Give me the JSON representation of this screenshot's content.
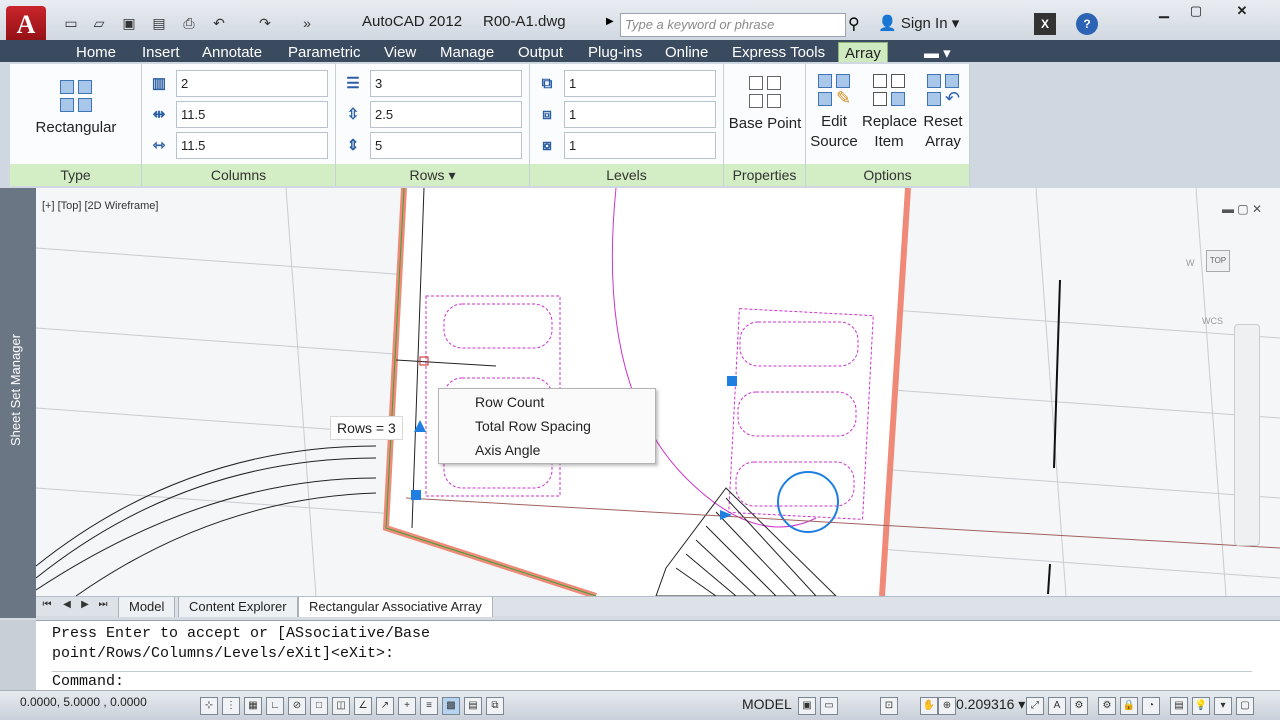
{
  "window": {
    "app_title": "AutoCAD 2012",
    "file_title": "R00-A1.dwg",
    "search_placeholder": "Type a keyword or phrase",
    "sign_in": "Sign In"
  },
  "ribbon_tabs": [
    "Home",
    "Insert",
    "Annotate",
    "Parametric",
    "View",
    "Manage",
    "Output",
    "Plug-ins",
    "Online",
    "Express Tools",
    "Array"
  ],
  "active_tab": "Array",
  "ribbon": {
    "type": {
      "button": "Rectangular",
      "label": "Type"
    },
    "columns": {
      "label": "Columns",
      "count": "2",
      "spacing": "11.5",
      "total": "11.5"
    },
    "rows": {
      "label": "Rows",
      "count": "3",
      "spacing": "2.5",
      "total": "5"
    },
    "levels": {
      "label": "Levels",
      "count": "1",
      "spacing": "1",
      "total": "1"
    },
    "properties": {
      "label": "Properties",
      "base_point": "Base Point"
    },
    "options": {
      "label": "Options",
      "edit_source_1": "Edit",
      "edit_source_2": "Source",
      "replace_item_1": "Replace",
      "replace_item_2": "Item",
      "reset_array_1": "Reset",
      "reset_array_2": "Array"
    }
  },
  "viewport": {
    "label": "[+] [Top] [2D Wireframe]",
    "viewcube_top": "TOP",
    "viewcube_w": "W",
    "wcs": "WCS"
  },
  "side_palette": "Sheet Set Manager",
  "context_menu": [
    "Row Count",
    "Total Row Spacing",
    "Axis Angle"
  ],
  "dynamic_input": "Rows = 3",
  "layout_tabs": [
    "Model",
    "Content Explorer",
    "Rectangular Associative Array"
  ],
  "command_line": {
    "line1": "Press Enter to accept or [ASsociative/Base",
    "line2": "point/Rows/Columns/Levels/eXit]<eXit>:",
    "prompt": "Command:"
  },
  "status_bar": {
    "coords": "0.0000, 5.0000 , 0.0000",
    "model": "MODEL",
    "scale": "0.209316"
  },
  "colors": {
    "accent_green": "#d3edc4",
    "tab_bar": "#3a4a5f",
    "road_edge": "#f08a78",
    "parking_magenta": "#cc33cc",
    "grip_blue": "#1f7fe0"
  }
}
